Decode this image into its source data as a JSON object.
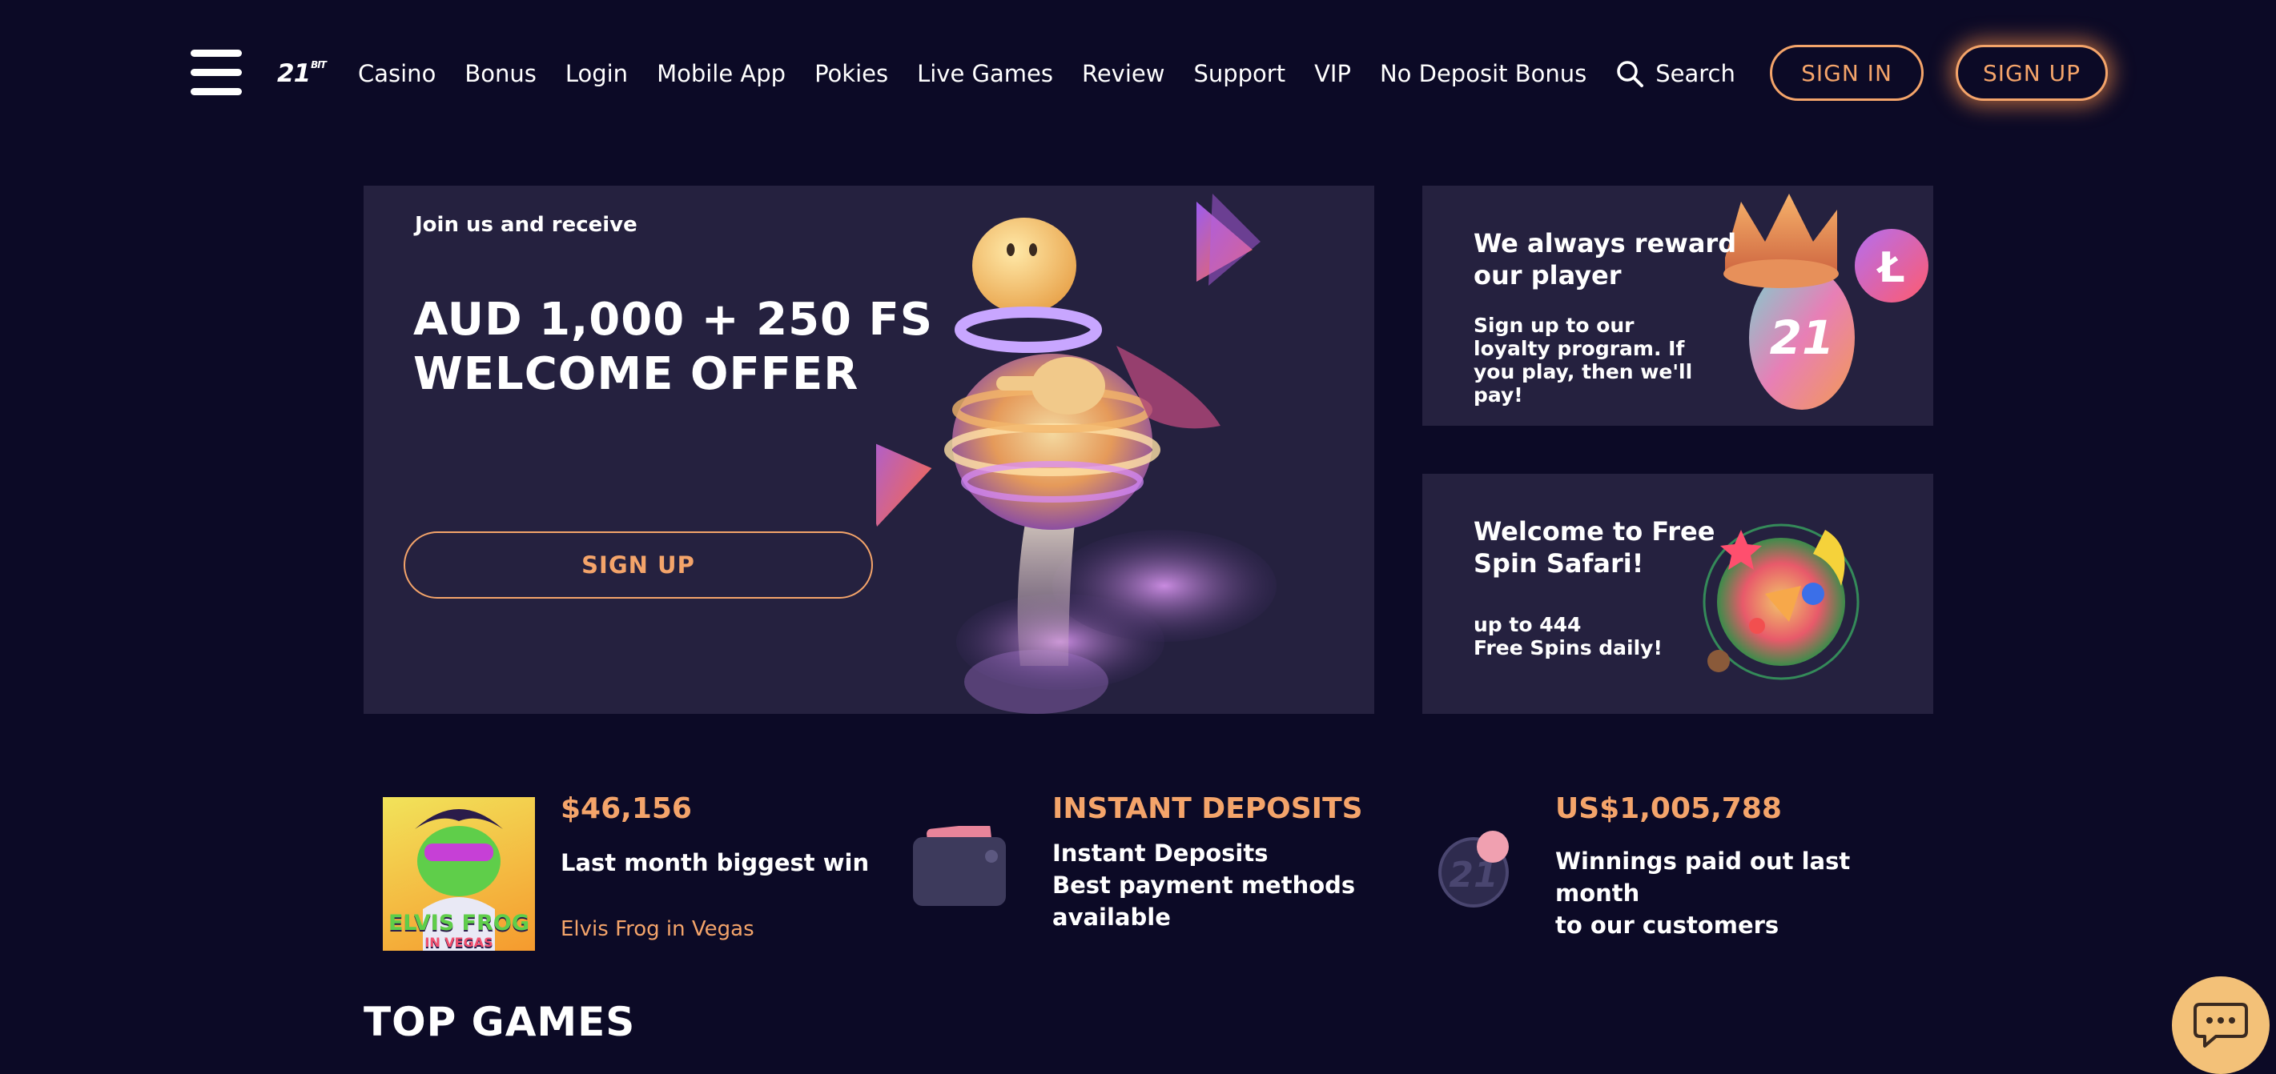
{
  "header": {
    "logo_text": "21",
    "logo_sub": "BIT",
    "nav": [
      "Casino",
      "Bonus",
      "Login",
      "Mobile App",
      "Pokies",
      "Live Games",
      "Review",
      "Support",
      "VIP",
      "No Deposit Bonus"
    ],
    "search_label": "Search",
    "signin_label": "SIGN IN",
    "signup_label": "SIGN UP"
  },
  "hero": {
    "kicker": "Join us and receive",
    "title_line1": "AUD 1,000 + 250 FS",
    "title_line2": "WELCOME OFFER",
    "button_label": "SIGN UP"
  },
  "cards": {
    "loyalty": {
      "title": "We always reward our player",
      "text": "Sign up to our loyalty program. If you play, then we'll pay!",
      "coin_text": "21"
    },
    "safari": {
      "title": "Welcome to Free Spin Safari!",
      "text_line1": "up to 444",
      "text_line2": "Free Spins daily!"
    }
  },
  "stats": {
    "biggest_win": {
      "value": "$46,156",
      "label": "Last month biggest win",
      "game": "Elvis Frog in Vegas",
      "thumb_line1": "ELVIS FROG",
      "thumb_line2": "IN VEGAS"
    },
    "deposits": {
      "value": "INSTANT DEPOSITS",
      "line1": "Instant Deposits",
      "line2": "Best payment methods",
      "line3": "available"
    },
    "winnings": {
      "value": "US$1,005,788",
      "line1": "Winnings paid out last month",
      "line2": "to our customers",
      "coin_text": "21"
    }
  },
  "sections": {
    "top_games": "TOP GAMES"
  },
  "colors": {
    "background": "#0c0a26",
    "card": "#25213f",
    "accent": "#f4a46a",
    "chat": "#f3c178"
  },
  "icons": {
    "menu": "hamburger-icon",
    "search": "search-icon",
    "chat": "chat-icon"
  }
}
